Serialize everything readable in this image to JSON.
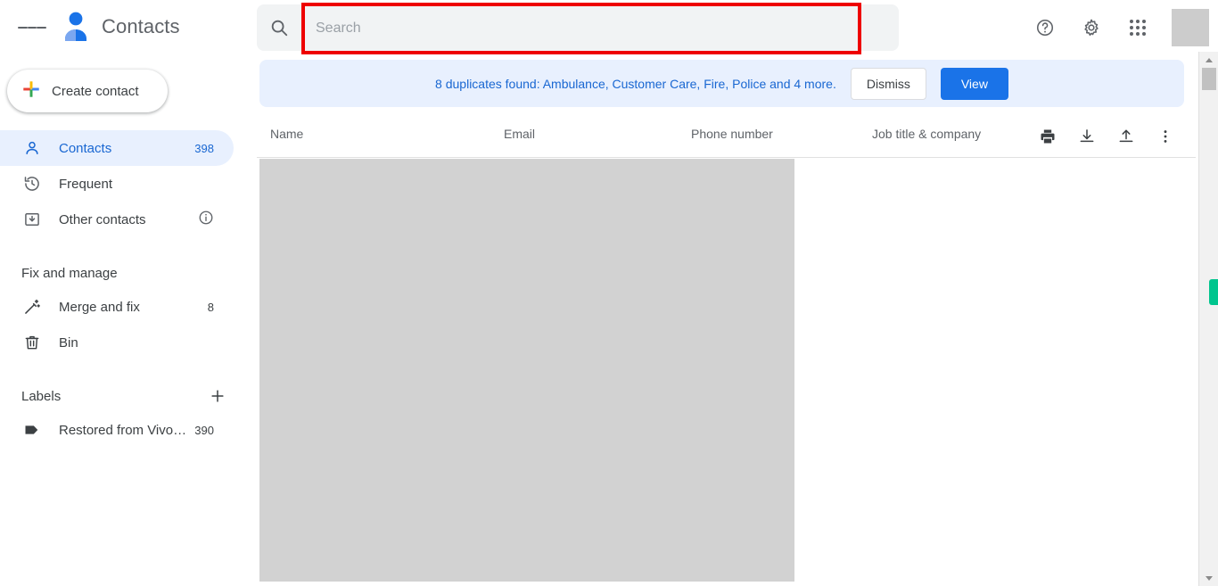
{
  "app": {
    "title": "Contacts",
    "accent_blue": "#1a73e8",
    "active_pill_bg": "#e8f0fe",
    "highlight_red": "#ee0000",
    "marker_green": "#00c58e"
  },
  "topbar": {
    "menu_icon": "hamburger-menu-icon",
    "logo_icon": "contacts-logo-icon",
    "help_icon": "help-circle-icon",
    "settings_icon": "gear-icon",
    "apps_icon": "apps-grid-icon",
    "avatar_icon": "user-avatar"
  },
  "search": {
    "icon": "search-icon",
    "value": "",
    "placeholder": "Search"
  },
  "sidebar": {
    "create_label": "Create contact",
    "create_icon": "plus-icon",
    "nav": [
      {
        "label": "Contacts",
        "count": "398",
        "icon": "person-outline-icon",
        "active": true
      },
      {
        "label": "Frequent",
        "count": "",
        "icon": "history-clock-icon",
        "active": false
      },
      {
        "label": "Other contacts",
        "count": "",
        "icon": "archive-box-icon",
        "active": false,
        "trailing_icon": "info-circle-icon"
      }
    ],
    "fix_and_manage_title": "Fix and manage",
    "manage": [
      {
        "label": "Merge and fix",
        "count": "8",
        "icon": "magic-wand-icon"
      },
      {
        "label": "Bin",
        "count": "",
        "icon": "trash-bin-icon"
      }
    ],
    "labels_title": "Labels",
    "labels_add_icon": "plus-icon",
    "labels": [
      {
        "label": "Restored from Vivo…",
        "count": "390",
        "icon": "label-tag-icon"
      }
    ]
  },
  "banner": {
    "text": "8 duplicates found: Ambulance, Customer Care, Fire, Police and 4 more.",
    "dismiss_label": "Dismiss",
    "view_label": "View"
  },
  "table": {
    "columns": {
      "name": "Name",
      "email": "Email",
      "phone": "Phone number",
      "job": "Job title & company"
    },
    "actions": [
      {
        "icon": "print-icon"
      },
      {
        "icon": "import-download-icon"
      },
      {
        "icon": "export-upload-icon"
      },
      {
        "icon": "more-vertical-icon"
      }
    ],
    "rows": []
  },
  "scrollbar": {
    "up_icon": "scroll-up-arrow-icon",
    "down_icon": "scroll-down-arrow-icon"
  }
}
